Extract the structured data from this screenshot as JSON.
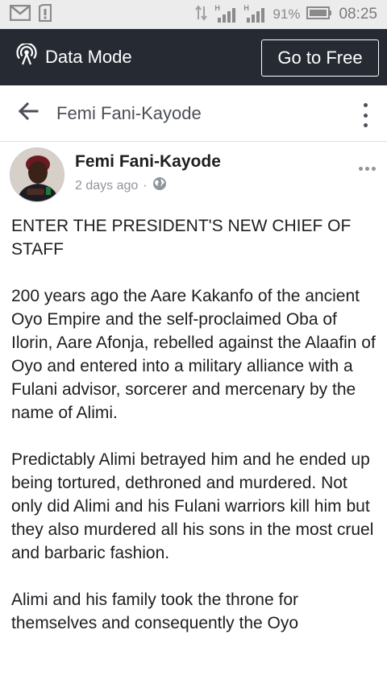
{
  "status_bar": {
    "signal1": "H",
    "signal2": "H",
    "battery_percent": "91%",
    "time": "08:25",
    "icons": [
      "gmail-icon",
      "sim-icon",
      "data-arrows-icon",
      "signal-icon",
      "battery-icon"
    ]
  },
  "data_mode_bar": {
    "label": "Data Mode",
    "button_label": "Go to Free",
    "icon": "broadcast-icon",
    "background": "#262a33"
  },
  "page_header": {
    "title": "Femi Fani-Kayode",
    "back_icon": "arrow-left-icon",
    "menu_icon": "kebab-menu-icon"
  },
  "post": {
    "author": "Femi Fani-Kayode",
    "time": "2 days ago",
    "separator": "·",
    "privacy_icon": "globe-icon",
    "paragraphs": [
      "ENTER THE PRESIDENT'S NEW CHIEF OF STAFF",
      "200 years ago the Aare Kakanfo of the ancient Oyo Empire and the self-proclaimed Oba of Ilorin, Aare Afonja, rebelled against the Alaafin of Oyo and entered into a military alliance with a Fulani advisor, sorcerer and mercenary by the name of Alimi.",
      "Predictably Alimi betrayed him and he ended up being tortured, dethroned and murdered. Not only did Alimi and his Fulani warriors kill him but they also murdered all his sons in the most cruel and barbaric fashion.",
      "Alimi and his family took the throne for themselves and consequently the Oyo"
    ]
  }
}
